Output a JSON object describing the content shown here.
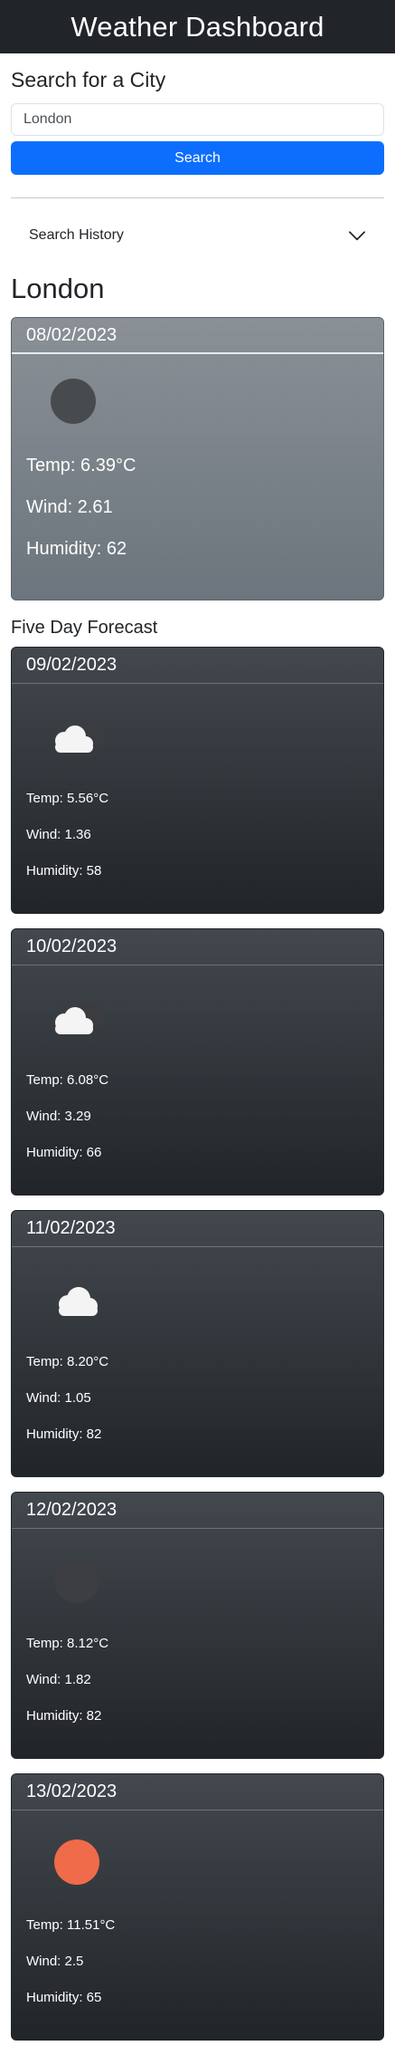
{
  "header": {
    "title": "Weather Dashboard"
  },
  "search": {
    "title": "Search for a City",
    "value": "London",
    "button_label": "Search"
  },
  "history": {
    "label": "Search History"
  },
  "current": {
    "city": "London",
    "date": "08/02/2023",
    "icon": "dark-moon-icon",
    "temp": "Temp: 6.39°C",
    "wind": "Wind: 2.61",
    "humidity": "Humidity: 62"
  },
  "forecast": {
    "title": "Five Day Forecast",
    "days": [
      {
        "date": "09/02/2023",
        "icon": "partly-cloudy-icon",
        "temp": "Temp: 5.56°C",
        "wind": "Wind: 1.36",
        "humidity": "Humidity: 58"
      },
      {
        "date": "10/02/2023",
        "icon": "partly-cloudy-icon",
        "temp": "Temp: 6.08°C",
        "wind": "Wind: 3.29",
        "humidity": "Humidity: 66"
      },
      {
        "date": "11/02/2023",
        "icon": "cloud-icon",
        "temp": "Temp: 8.20°C",
        "wind": "Wind: 1.05",
        "humidity": "Humidity: 82"
      },
      {
        "date": "12/02/2023",
        "icon": "dark-moon-icon",
        "temp": "Temp: 8.12°C",
        "wind": "Wind: 1.82",
        "humidity": "Humidity: 82"
      },
      {
        "date": "13/02/2023",
        "icon": "sun-icon",
        "temp": "Temp: 11.51°C",
        "wind": "Wind: 2.5",
        "humidity": "Humidity: 65"
      }
    ]
  },
  "colors": {
    "navbar": "#212529",
    "primary": "#0d6efd",
    "current_card": "#6c757d",
    "forecast_card": "#212529",
    "sun": "#ef6b4a"
  }
}
